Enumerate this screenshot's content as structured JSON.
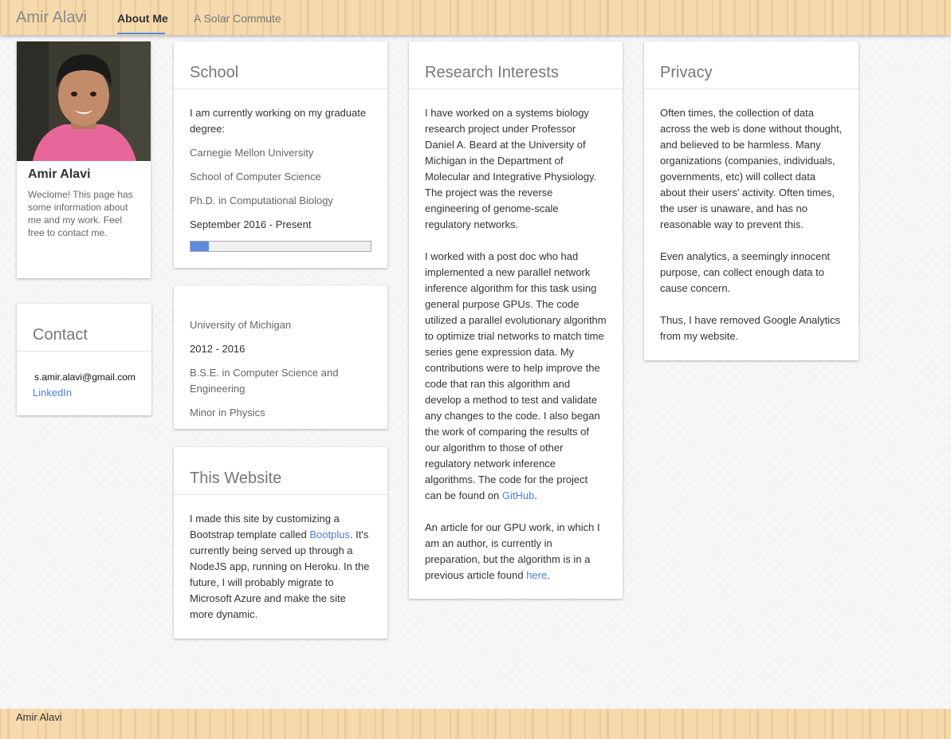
{
  "nav": {
    "brand": "Amir Alavi",
    "links": [
      {
        "label": "About Me",
        "active": true
      },
      {
        "label": "A Solar Commute",
        "active": false
      }
    ]
  },
  "profile": {
    "name": "Amir Alavi",
    "blurb": "Weclome! This page has some information about me and my work. Feel free to contact me."
  },
  "contact": {
    "title": "Contact",
    "email": "s.amir.alavi@gmail.com",
    "linkedin": "LinkedIn"
  },
  "school": {
    "title": "School",
    "intro": "I am currently working on my graduate degree:",
    "university": "Carnegie Mellon University",
    "college": "School of Computer Science",
    "degree": "Ph.D. in Computational Biology",
    "dates": "September 2016 - Present",
    "progress_fraction": 0.1
  },
  "undergrad": {
    "university": "University of Michigan",
    "dates": "2012 - 2016",
    "degree": "B.S.E. in Computer Science and Engineering",
    "minor": "Minor in Physics"
  },
  "website": {
    "title": "This Website",
    "text_before": "I made this site by customizing a Bootstrap template called ",
    "link": "Bootplus",
    "text_after": ". It's currently being served up through a NodeJS app, running on Heroku. In the future, I will probably migrate to Microsoft Azure and make the site more dynamic."
  },
  "research": {
    "title": "Research Interests",
    "p1": "I have worked on a systems biology research project under Professor Daniel A. Beard at the University of Michigan in the Department of Molecular and Integrative Physiology. The project was the reverse engineering of genome-scale regulatory networks.",
    "p2_before": "I worked with a post doc who had implemented a new parallel network inference algorithm for this task using general purpose GPUs. The code utilized a parallel evolutionary algorithm to optimize trial networks to match time series gene expression data. My contributions were to help improve the code that ran this algorithm and develop a method to test and validate any changes to the code. I also began the work of comparing the results of our algorithm to those of other regulatory network inference algorithms. The code for the project can be found on ",
    "p2_link": "GitHub",
    "p2_after": ".",
    "p3_before": "An article for our GPU work, in which I am an author, is currently in preparation, but the algorithm is in a previous article found ",
    "p3_link": "here",
    "p3_after": "."
  },
  "privacy": {
    "title": "Privacy",
    "p1": "Often times, the collection of data across the web is done without thought, and believed to be harmless. Many organizations (companies, individuals, governments, etc) will collect data about their users' activity. Often times, the user is unaware, and has no reasonable way to prevent this.",
    "p2": "Even analytics, a seemingly innocent purpose, can collect enough data to cause concern.",
    "p3": "Thus, I have removed Google Analytics from my website."
  },
  "footer": {
    "text": "Amir Alavi"
  },
  "colors": {
    "accent": "#5b8be0",
    "link": "#4a7ee0",
    "wood": "#f4d8a8"
  }
}
